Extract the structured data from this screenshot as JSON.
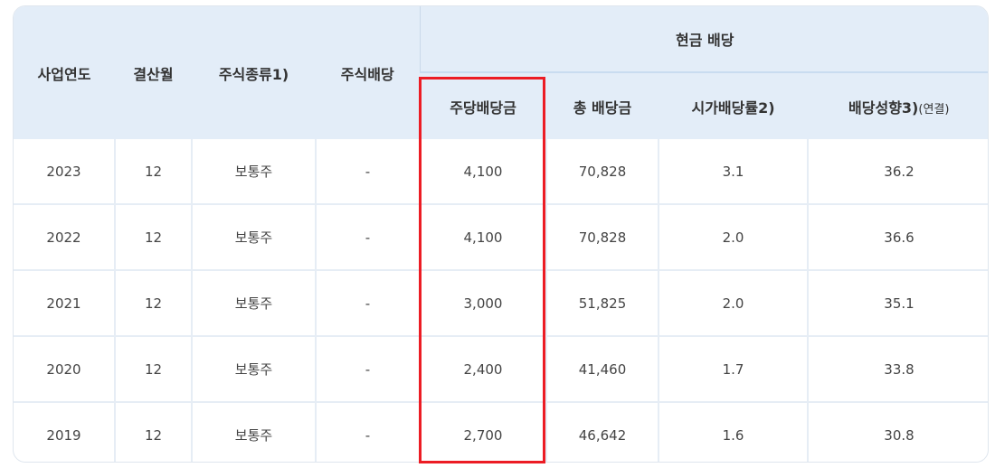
{
  "table": {
    "headers": {
      "year": "사업연도",
      "month": "결산월",
      "stock_type": "주식종류1)",
      "stock_dividend": "주식배당",
      "cash_group": "현금 배당",
      "per_share": "주당배당금",
      "total": "총 배당금",
      "yield": "시가배당률2)",
      "payout": "배당성향3)",
      "payout_note": "(연결)"
    },
    "rows": [
      {
        "year": "2023",
        "month": "12",
        "type": "보통주",
        "stock": "-",
        "per_share": "4,100",
        "total": "70,828",
        "yield": "3.1",
        "payout": "36.2"
      },
      {
        "year": "2022",
        "month": "12",
        "type": "보통주",
        "stock": "-",
        "per_share": "4,100",
        "total": "70,828",
        "yield": "2.0",
        "payout": "36.6"
      },
      {
        "year": "2021",
        "month": "12",
        "type": "보통주",
        "stock": "-",
        "per_share": "3,000",
        "total": "51,825",
        "yield": "2.0",
        "payout": "35.1"
      },
      {
        "year": "2020",
        "month": "12",
        "type": "보통주",
        "stock": "-",
        "per_share": "2,400",
        "total": "41,460",
        "yield": "1.7",
        "payout": "33.8"
      },
      {
        "year": "2019",
        "month": "12",
        "type": "보통주",
        "stock": "-",
        "per_share": "2,700",
        "total": "46,642",
        "yield": "1.6",
        "payout": "30.8"
      }
    ]
  },
  "colors": {
    "header_bg": "#e3edf8",
    "highlight": "#ec1c24"
  }
}
